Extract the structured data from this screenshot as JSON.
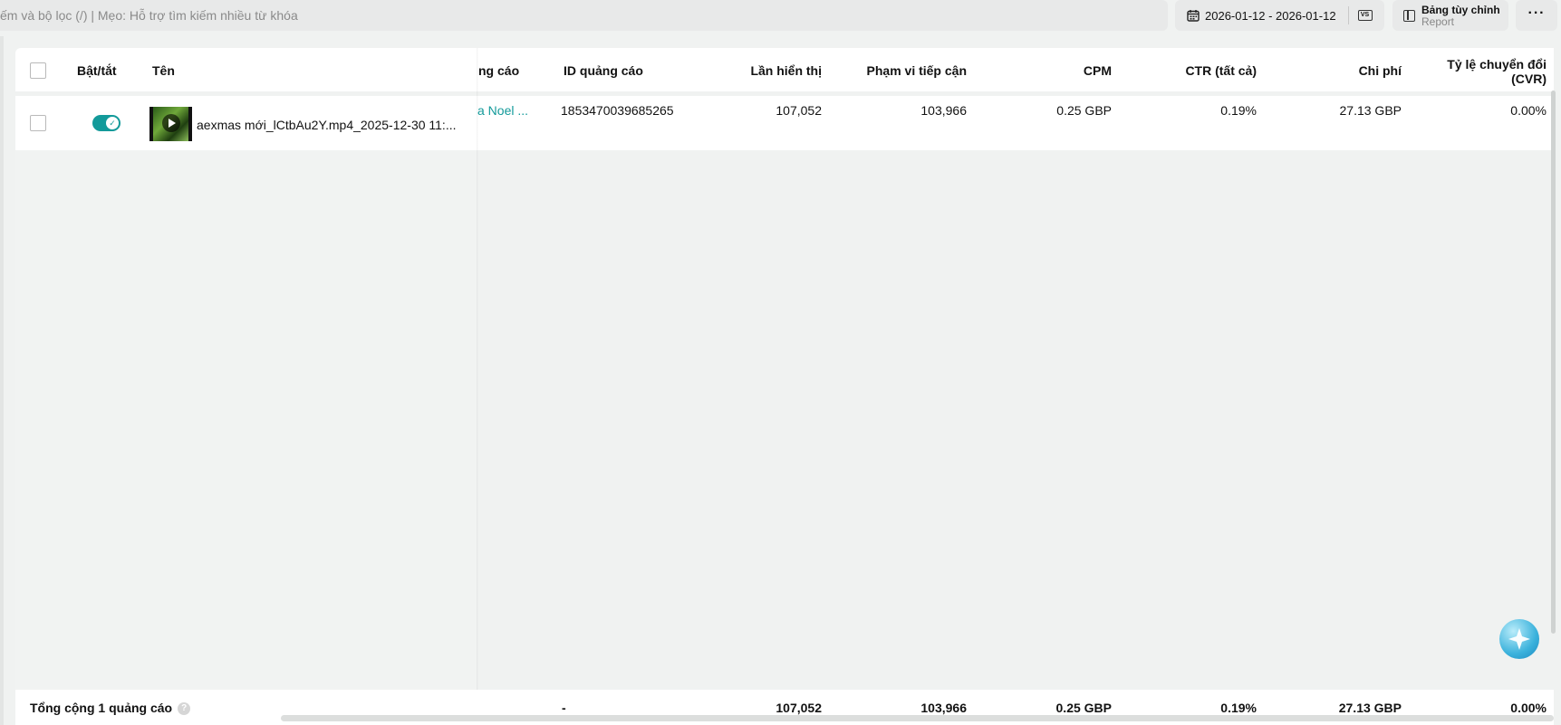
{
  "toolbar": {
    "search_placeholder": "ếm và bộ lọc (/) | Mẹo: Hỗ trợ tìm kiếm nhiều từ khóa",
    "date_range": "2026-01-12 - 2026-01-12",
    "compare_label": "VS",
    "custom_table_label": "Bảng tùy chỉnh",
    "custom_table_sub": "Report",
    "more_label": "···"
  },
  "table": {
    "headers": {
      "toggle": "Bật/tắt",
      "name": "Tên",
      "ad_group": "ng cáo",
      "ad_id": "ID quảng cáo",
      "impressions": "Lần hiển thị",
      "reach": "Phạm vi tiếp cận",
      "cpm": "CPM",
      "ctr": "CTR (tất cả)",
      "cost": "Chi phí",
      "cvr_line1": "Tỷ lệ chuyển đổi",
      "cvr_line2": "(CVR)"
    },
    "rows": [
      {
        "name": "aexmas mới_lCtbAu2Y.mp4_2025-12-30 11:...",
        "ad_group": "a Noel ...",
        "ad_id": "1853470039685265",
        "impressions": "107,052",
        "reach": "103,966",
        "cpm": "0.25 GBP",
        "ctr": "0.19%",
        "cost": "27.13 GBP",
        "cvr": "0.00%",
        "enabled": true
      }
    ],
    "footer": {
      "label": "Tổng cộng 1 quảng cáo",
      "help": "?",
      "ad_id": "-",
      "impressions": "107,052",
      "reach": "103,966",
      "cpm": "0.25 GBP",
      "ctr": "0.19%",
      "cost": "27.13 GBP",
      "cvr": "0.00%"
    }
  },
  "colors": {
    "accent": "#139a9a",
    "background": "#f0f2f1"
  }
}
